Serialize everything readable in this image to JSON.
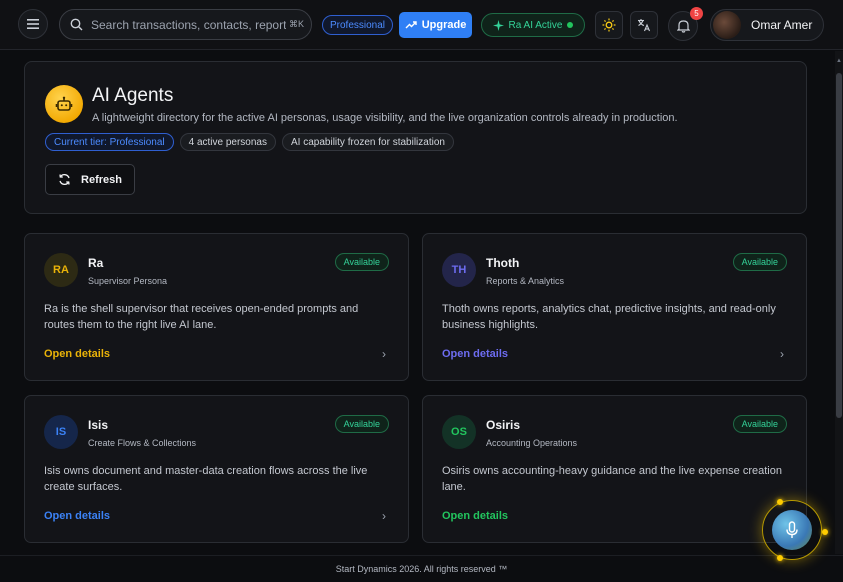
{
  "topbar": {
    "search_placeholder": "Search transactions, contacts, reports",
    "search_shortcut": "⌘K",
    "plan_badge": "Professional",
    "upgrade_label": "Upgrade",
    "ra_status_label": "Ra AI Active",
    "notification_count": "5",
    "user_name": "Omar Amer",
    "icons": [
      "menu-icon",
      "search-icon",
      "trending-up-icon",
      "sparkle-icon",
      "sun-icon",
      "translate-icon",
      "bell-icon"
    ]
  },
  "hero": {
    "title": "AI Agents",
    "subtitle": "A lightweight directory for the active AI personas, usage visibility, and the live organization controls already in production.",
    "chips": [
      "Current tier: Professional",
      "4 active personas",
      "AI capability frozen for stabilization"
    ],
    "refresh_label": "Refresh"
  },
  "agents": [
    {
      "initials": "RA",
      "name": "Ra",
      "role": "Supervisor Persona",
      "status": "Available",
      "description": "Ra is the shell supervisor that receives open-ended prompts and routes them to the right live AI lane.",
      "link": "Open details",
      "accent": "#eab308",
      "avatar_bg": "#2d2a14"
    },
    {
      "initials": "TH",
      "name": "Thoth",
      "role": "Reports & Analytics",
      "status": "Available",
      "description": "Thoth owns reports, analytics chat, predictive insights, and read-only business highlights.",
      "link": "Open details",
      "accent": "#6d6cf0",
      "avatar_bg": "#23254a"
    },
    {
      "initials": "IS",
      "name": "Isis",
      "role": "Create Flows & Collections",
      "status": "Available",
      "description": "Isis owns document and master-data creation flows across the live create surfaces.",
      "link": "Open details",
      "accent": "#3b82f6",
      "avatar_bg": "#15264a"
    },
    {
      "initials": "OS",
      "name": "Osiris",
      "role": "Accounting Operations",
      "status": "Available",
      "description": "Osiris owns accounting-heavy guidance and the live expense creation lane.",
      "link": "Open details",
      "accent": "#22c55e",
      "avatar_bg": "#133226"
    }
  ],
  "footer": {
    "text": "Start Dynamics 2026. All rights reserved ™"
  },
  "colors": {
    "accent_blue": "#2f7ff5",
    "status_green": "#34d399",
    "bot_yellow": "#f2a800"
  }
}
